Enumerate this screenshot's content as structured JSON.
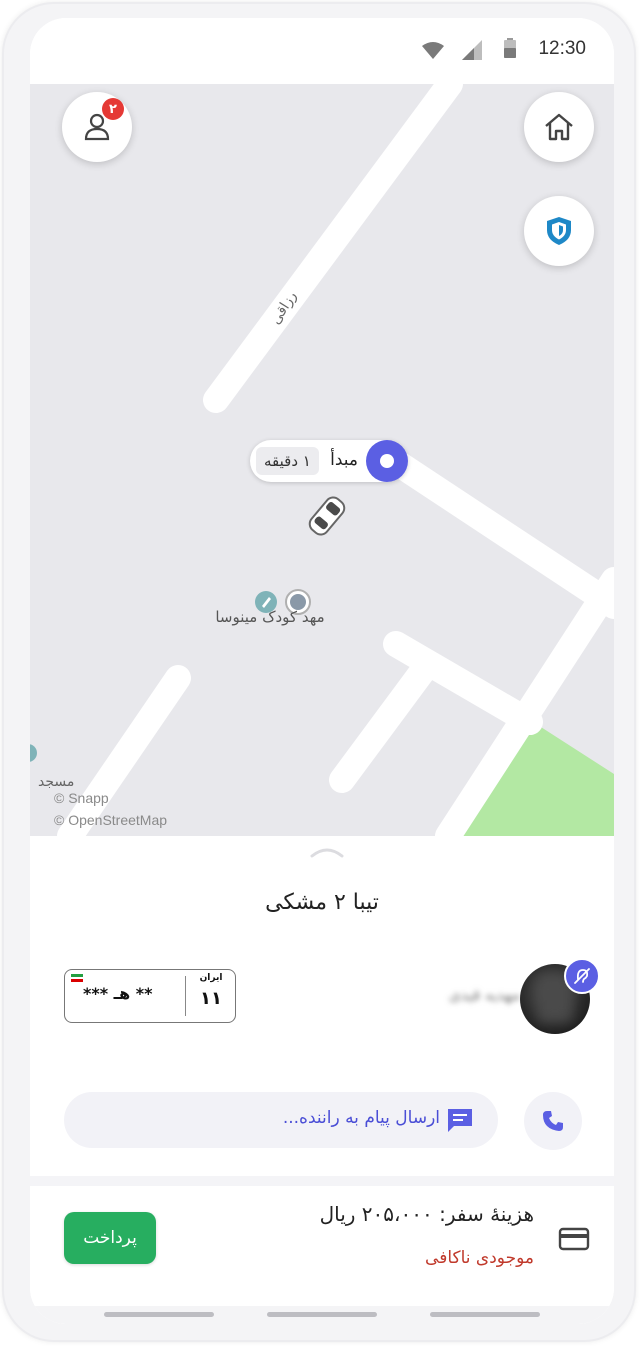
{
  "status_bar": {
    "time": "12:30"
  },
  "map": {
    "profile_badge_count": "۲",
    "street_label": "رزاقی",
    "origin_label": "مبدأ",
    "origin_eta": "۱ دقیقه",
    "poi_label": "مهد کودک مینوسا",
    "mosque_label": "مسجد",
    "attribution_snapp": "© Snapp",
    "attribution_osm": "© OpenStreetMap"
  },
  "trip": {
    "vehicle_title": "تیبا ۲ مشکی",
    "plate_main": "** هـ ***",
    "plate_country": "ایران",
    "plate_region": "۱۱",
    "driver_name": "مهدیه قیدی",
    "message_placeholder": "ارسال پیام به راننده...",
    "fare_text": "هزینهٔ سفر: ۲۰۵،۰۰۰ ریال",
    "balance_warning": "موجودی ناکافی",
    "pay_button_label": "پرداخت"
  },
  "colors": {
    "accent": "#5b5fe3",
    "pay_green": "#27ae60",
    "warning_red": "#c0392b",
    "map_bg": "#e8e8ec",
    "park_green": "#b3e8a3"
  },
  "icons": [
    "wifi-icon",
    "signal-icon",
    "battery-icon",
    "user-icon",
    "home-icon",
    "shield-icon",
    "car-icon",
    "poi-icon",
    "message-icon",
    "phone-icon",
    "card-icon",
    "deaf-icon"
  ]
}
